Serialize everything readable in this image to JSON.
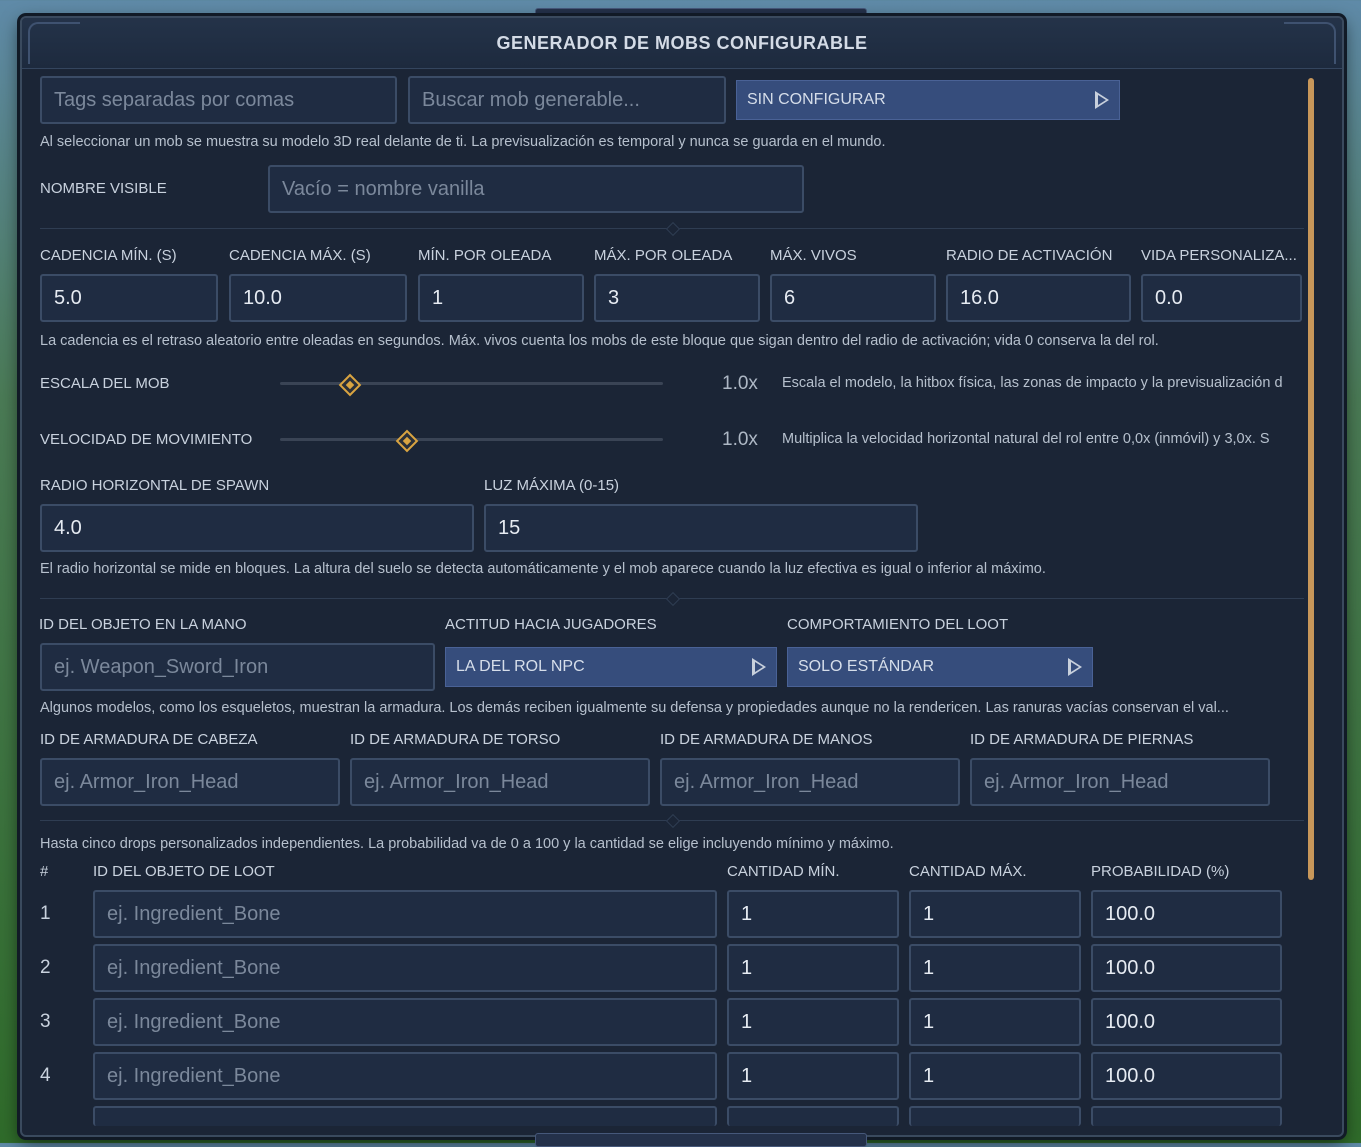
{
  "title": "GENERADOR DE MOBS CONFIGURABLE",
  "top": {
    "tags_placeholder": "Tags separadas por comas",
    "search_placeholder": "Buscar mob generable...",
    "mob_select": "SIN CONFIGURAR",
    "help": "Al seleccionar un mob se muestra su modelo 3D real delante de ti. La previsualización es temporal y nunca se guarda en el mundo."
  },
  "name": {
    "label": "NOMBRE VISIBLE",
    "placeholder": "Vacío = nombre vanilla"
  },
  "spawn": {
    "labels": [
      "CADENCIA MÍN. (S)",
      "CADENCIA MÁX. (S)",
      "MÍN. POR OLEADA",
      "MÁX. POR OLEADA",
      "MÁX. VIVOS",
      "RADIO DE ACTIVACIÓN",
      "VIDA PERSONALIZA..."
    ],
    "values": [
      "5.0",
      "10.0",
      "1",
      "3",
      "6",
      "16.0",
      "0.0"
    ],
    "help": "La cadencia es el retraso aleatorio entre oleadas en segundos. Máx. vivos cuenta los mobs de este bloque que sigan dentro del radio de activación; vida 0 conserva la del rol."
  },
  "scale": {
    "label": "ESCALA DEL MOB",
    "value": "1.0x",
    "level": 0.18,
    "help": "Escala el modelo, la hitbox física, las zonas de impacto y la previsualización d"
  },
  "speed": {
    "label": "VELOCIDAD DE MOVIMIENTO",
    "value": "1.0x",
    "level": 0.33,
    "help": "Multiplica la velocidad horizontal natural del rol entre 0,0x (inmóvil) y 3,0x. S"
  },
  "radius": {
    "label": "RADIO HORIZONTAL DE SPAWN",
    "value": "4.0",
    "light_label": "LUZ MÁXIMA (0-15)",
    "light_value": "15",
    "help": "El radio horizontal se mide en bloques. La altura del suelo se detecta automáticamente y el mob aparece cuando la luz efectiva es igual o inferior al máximo."
  },
  "equip": {
    "hand_label": "ID DEL OBJETO EN LA MANO",
    "hand_placeholder": "ej. Weapon_Sword_Iron",
    "attitude_label": "ACTITUD HACIA JUGADORES",
    "attitude_value": "LA DEL ROL NPC",
    "loot_label": "COMPORTAMIENTO DEL LOOT",
    "loot_value": "SOLO ESTÁNDAR",
    "help": "Algunos modelos, como los esqueletos, muestran la armadura. Los demás reciben igualmente su defensa y propiedades aunque no la rendericen. Las ranuras vacías conservan el val..."
  },
  "armor": {
    "labels": [
      "ID DE ARMADURA DE CABEZA",
      "ID DE ARMADURA DE TORSO",
      "ID DE ARMADURA DE MANOS",
      "ID DE ARMADURA DE PIERNAS"
    ],
    "placeholder": "ej. Armor_Iron_Head"
  },
  "drops": {
    "help": "Hasta cinco drops personalizados independientes. La probabilidad va de 0 a 100 y la cantidad se elige incluyendo mínimo y máximo.",
    "headers": [
      "#",
      "ID DEL OBJETO DE LOOT",
      "CANTIDAD MÍN.",
      "CANTIDAD MÁX.",
      "PROBABILIDAD (%)"
    ],
    "placeholder": "ej. Ingredient_Bone",
    "rows": [
      {
        "n": "1",
        "min": "1",
        "max": "1",
        "prob": "100.0"
      },
      {
        "n": "2",
        "min": "1",
        "max": "1",
        "prob": "100.0"
      },
      {
        "n": "3",
        "min": "1",
        "max": "1",
        "prob": "100.0"
      },
      {
        "n": "4",
        "min": "1",
        "max": "1",
        "prob": "100.0"
      }
    ]
  }
}
